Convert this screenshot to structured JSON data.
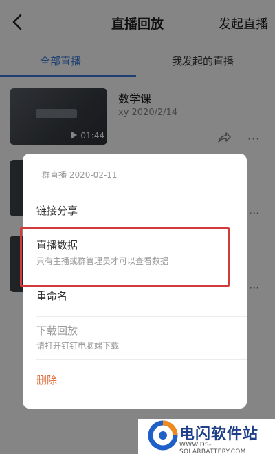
{
  "header": {
    "title": "直播回放",
    "start_live": "发起直播"
  },
  "tabs": [
    {
      "label": "全部直播",
      "active": true
    },
    {
      "label": "我发起的直播",
      "active": false
    }
  ],
  "list": [
    {
      "title": "数学课",
      "meta": "xy  2020/2/14",
      "duration": "01:44"
    }
  ],
  "sheet": {
    "header": "群直播 2020-02-11",
    "items": [
      {
        "label": "链接分享"
      },
      {
        "label": "直播数据",
        "sub": "只有主播或群管理员才可以查看数据",
        "highlighted": true
      },
      {
        "label": "重命名"
      },
      {
        "label": "下载回放",
        "sub": "请打开钉钉电脑端下载",
        "disabled": true
      },
      {
        "label": "删除",
        "danger": true
      }
    ]
  },
  "watermark": {
    "title": "电闪软件站",
    "url": "WWW.DS-SOLARBATTERY.COM"
  },
  "colors": {
    "accent": "#3b7bd8",
    "highlight": "#d03a3a",
    "danger": "#e07040"
  }
}
